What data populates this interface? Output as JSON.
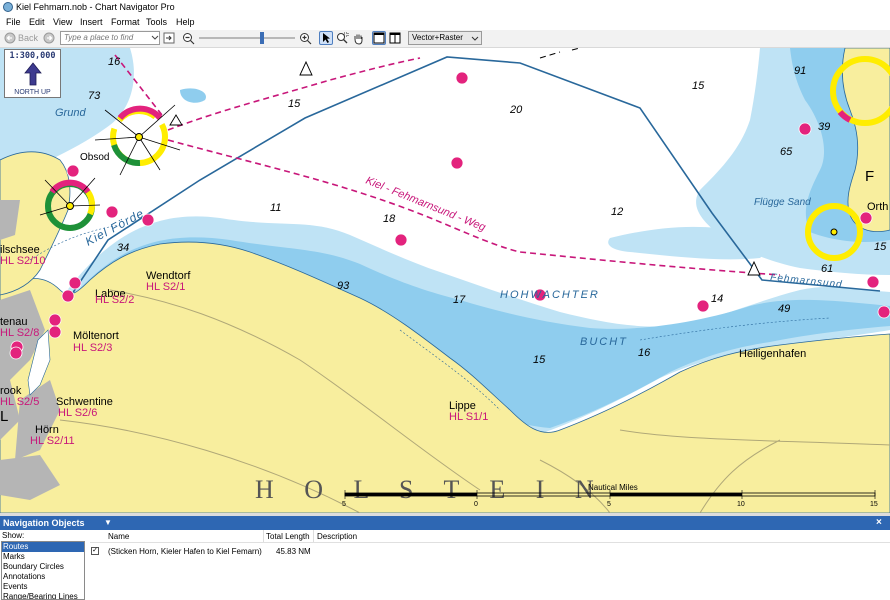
{
  "window": {
    "title": "Kiel Fehmarn.nob - Chart Navigator Pro"
  },
  "menu": [
    "File",
    "Edit",
    "View",
    "Insert",
    "Format",
    "Tools",
    "Help"
  ],
  "toolbar": {
    "back_label": "Back",
    "place_placeholder": "Type a place to find",
    "view_mode": "Vector+Raster",
    "icons": [
      "back-arrow-icon",
      "forward-arrow-icon",
      "dropdown-arrow-icon",
      "go-arrow-icon",
      "zoom-out-icon",
      "zoom-slider",
      "zoom-in-icon",
      "select-pointer-icon",
      "zoom-rectangle-icon",
      "pan-hand-icon",
      "single-pane-icon",
      "split-pane-icon"
    ]
  },
  "map": {
    "scale": "1:300,000",
    "orientation": "NORTH UP",
    "region": "H O L S T E I N",
    "route_name": "Kiel - Fehmarnsund - Weg",
    "water_names": [
      "Grund",
      "Kiel Förde",
      "HOHWACHTER",
      "BUCHT",
      "Flügge Sand",
      "Fehmarnsund"
    ],
    "places": [
      "Obsod",
      "Laboe",
      "Wendtorf",
      "Möltenort",
      "Schwentine",
      "Hörn",
      "Lippe",
      "Heiligenhafen",
      "Orth",
      "ilschsee",
      "tenau",
      "rook"
    ],
    "harbours": [
      "HL S2/10",
      "HL S2/1",
      "HL S2/2",
      "HL S2/3",
      "HL S2/8",
      "HL S2/5",
      "HL S2/6",
      "HL S2/11",
      "HL S1/1"
    ],
    "soundings": [
      "16",
      "73",
      "15",
      "20",
      "15",
      "91",
      "39",
      "65",
      "11",
      "18",
      "12",
      "15",
      "61",
      "34",
      "93",
      "17",
      "14",
      "49",
      "15",
      "16"
    ],
    "side_letters": [
      "F",
      "L"
    ],
    "scale_bar": {
      "title": "Nautical Miles",
      "ticks": [
        "5",
        "0",
        "5",
        "10",
        "15"
      ]
    }
  },
  "nav_panel": {
    "title": "Navigation Objects",
    "show_label": "Show:",
    "show_items": [
      "Routes",
      "Marks",
      "Boundary Circles",
      "Annotations",
      "Events",
      "Range/Bearing Lines"
    ],
    "selected_item": "Routes",
    "columns": [
      "Name",
      "Total Length",
      "Description"
    ],
    "rows": [
      {
        "checked": true,
        "name": "(Sticken Horn, Kieler Hafen to Kiel Femarn)",
        "length": "45.83 NM",
        "description": ""
      }
    ]
  },
  "colors": {
    "land": "#f8ee9e",
    "deep_water": "#ffffff",
    "shallow_water": "#bfe3f5",
    "very_shallow": "#8fcdee",
    "harbor_magenta": "#c8177a",
    "route_line": "#29689b",
    "panel_header": "#2e67b3"
  }
}
